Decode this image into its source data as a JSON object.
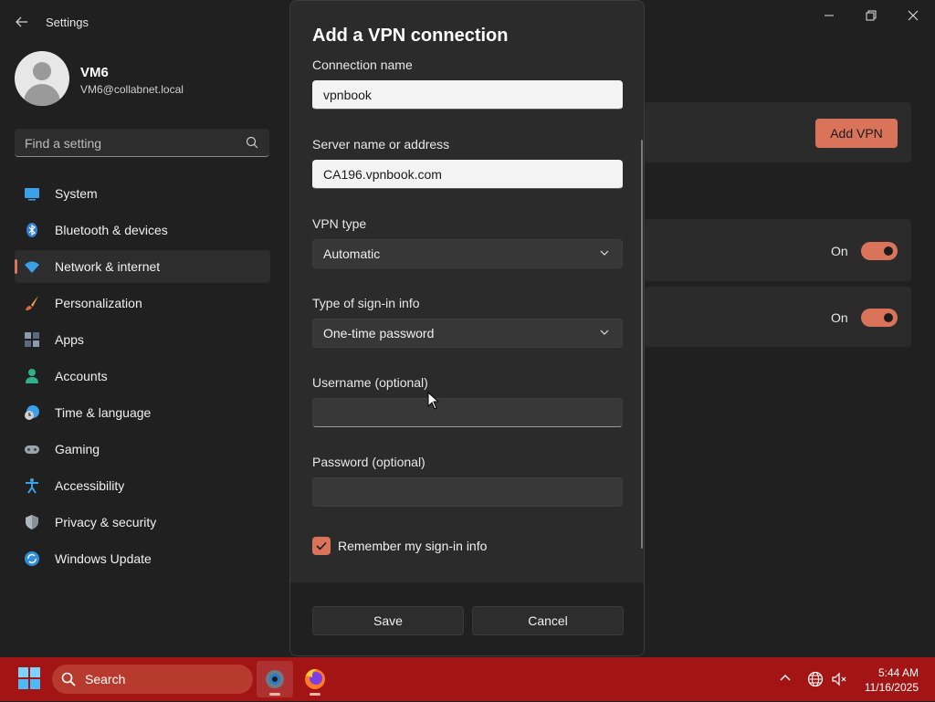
{
  "window": {
    "title": "Settings",
    "back_icon": "back-arrow-icon",
    "controls": {
      "minimize": "—",
      "maximize": "❐",
      "close": "✕"
    }
  },
  "profile": {
    "name": "VM6",
    "email": "VM6@collabnet.local"
  },
  "search": {
    "placeholder": "Find a setting"
  },
  "sidebar": {
    "items": [
      {
        "label": "System",
        "icon": "system-icon"
      },
      {
        "label": "Bluetooth & devices",
        "icon": "bluetooth-icon"
      },
      {
        "label": "Network & internet",
        "icon": "network-icon",
        "selected": true
      },
      {
        "label": "Personalization",
        "icon": "brush-icon"
      },
      {
        "label": "Apps",
        "icon": "apps-icon"
      },
      {
        "label": "Accounts",
        "icon": "accounts-icon"
      },
      {
        "label": "Time & language",
        "icon": "time-language-icon"
      },
      {
        "label": "Gaming",
        "icon": "gaming-icon"
      },
      {
        "label": "Accessibility",
        "icon": "accessibility-icon"
      },
      {
        "label": "Privacy & security",
        "icon": "shield-icon"
      },
      {
        "label": "Windows Update",
        "icon": "update-icon"
      }
    ]
  },
  "main": {
    "add_vpn_label": "Add VPN",
    "toggle1": {
      "label": "On",
      "state": true
    },
    "toggle2": {
      "label": "On",
      "state": true
    }
  },
  "dialog": {
    "title": "Add a VPN connection",
    "connection_name": {
      "label": "Connection name",
      "value": "vpnbook"
    },
    "server": {
      "label": "Server name or address",
      "value": "CA196.vpnbook.com"
    },
    "vpn_type": {
      "label": "VPN type",
      "value": "Automatic"
    },
    "sign_in_type": {
      "label": "Type of sign-in info",
      "value": "One-time password"
    },
    "username": {
      "label": "Username (optional)",
      "value": ""
    },
    "password": {
      "label": "Password (optional)",
      "value": ""
    },
    "remember": {
      "label": "Remember my sign-in info",
      "checked": true
    },
    "save_label": "Save",
    "cancel_label": "Cancel"
  },
  "taskbar": {
    "search_label": "Search",
    "time": "5:44 AM",
    "date": "11/16/2025"
  },
  "colors": {
    "accent": "#d9735a",
    "taskbar": "#a31515",
    "background": "#202020"
  }
}
